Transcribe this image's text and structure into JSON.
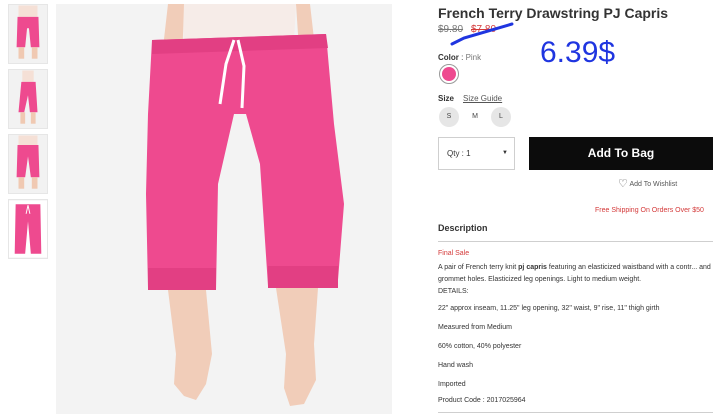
{
  "product": {
    "title": "French Terry Drawstring PJ Capris",
    "price_original": "$9.80",
    "price_sale": "$7.80",
    "handwritten_price": "6.39$",
    "color_label": "Color",
    "color_separator": " : ",
    "color_value": "Pink",
    "swatch_color": "#ee4a8f",
    "size_label": "Size",
    "size_guide": "Size Guide",
    "sizes": [
      "S",
      "M",
      "L"
    ],
    "quantity": "Qty : 1",
    "add_to_bag": "Add To Bag",
    "wishlist": "Add To Wishlist",
    "shipping": "Free Shipping On Orders Over $50",
    "description_heading": "Description",
    "final_sale": "Final Sale",
    "description_before_bold": "A pair of French terry knit ",
    "description_bold": "pj capris",
    "description_after_bold": " featuring an elasticized waistband with a contr... and grommet holes. Elasticized leg openings. Light to medium weight.",
    "details_label": "DETAILS:",
    "details": [
      "22\" approx inseam, 11.25\" leg opening, 32\" waist, 9\" rise, 11\" thigh girth",
      "Measured from Medium",
      "60% cotton, 40% polyester",
      "Hand wash",
      "Imported",
      "Product Code : 2017025964"
    ]
  },
  "colors": {
    "sale_red": "#d43a3a",
    "annotation_blue": "#1f35e0",
    "bag_button": "#0c0c0c",
    "pants_pink": "#ee4a8f"
  }
}
